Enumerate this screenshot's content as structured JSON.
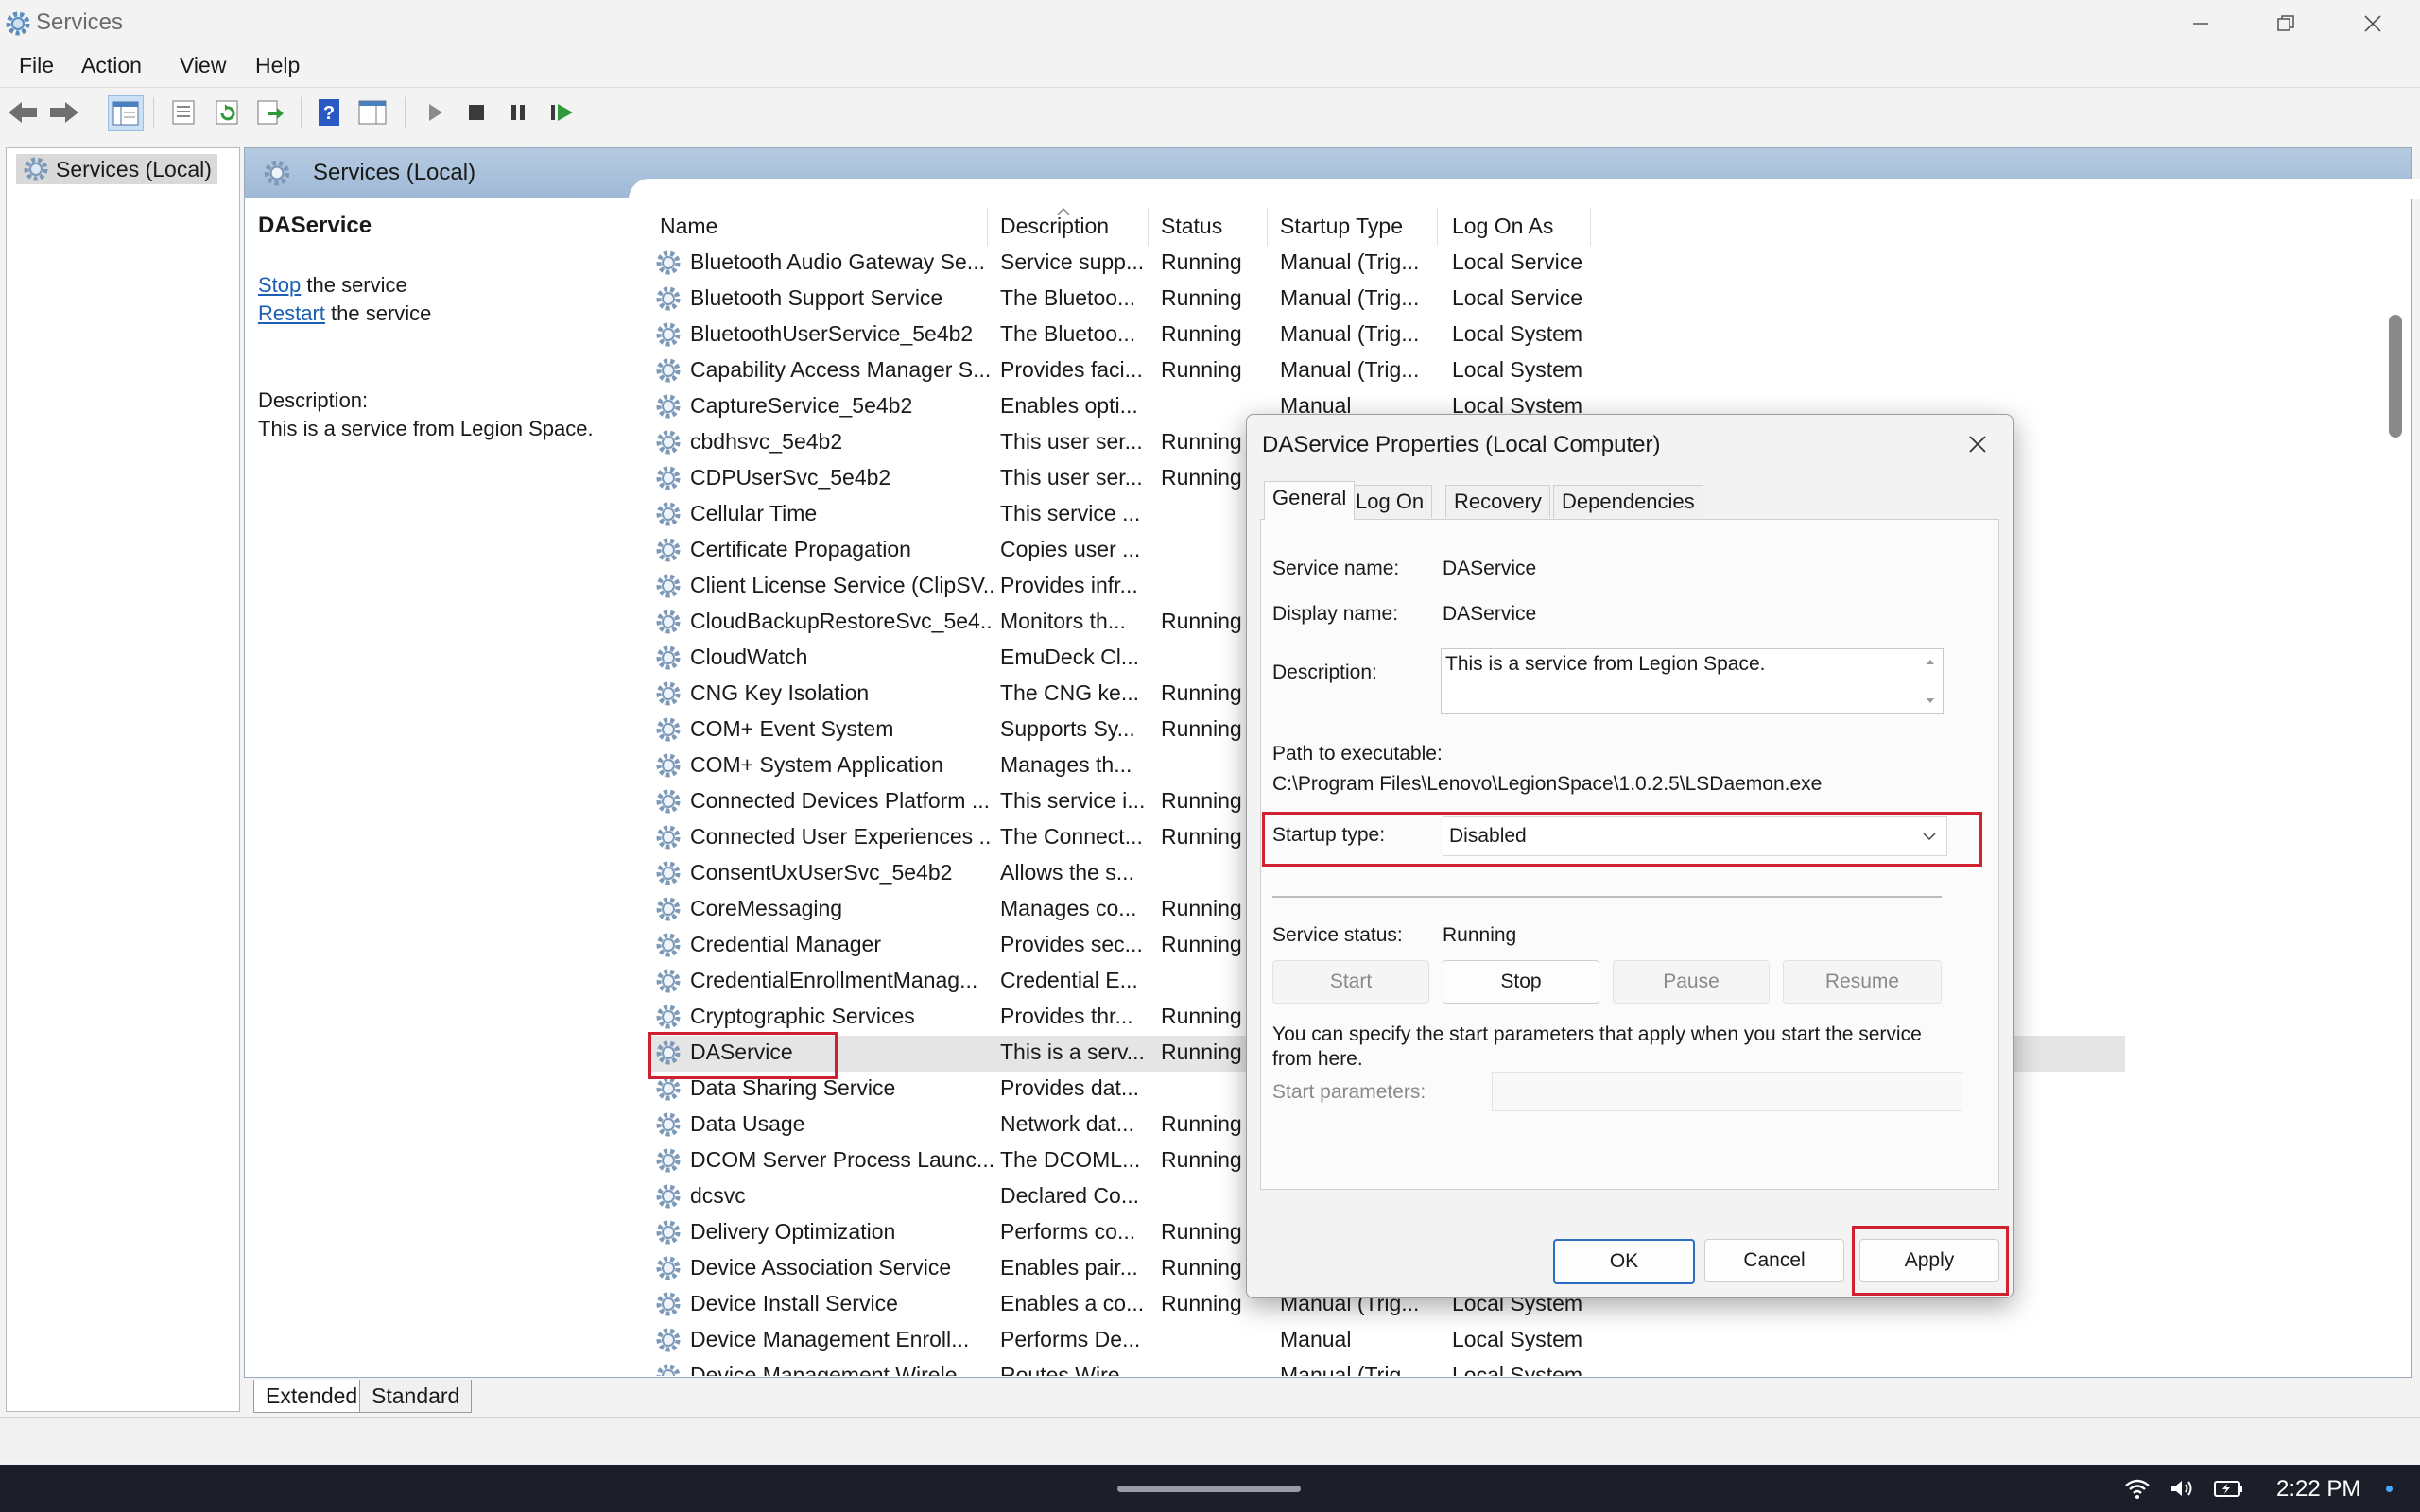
{
  "window": {
    "title": "Services"
  },
  "menu": [
    "File",
    "Action",
    "View",
    "Help"
  ],
  "tree": {
    "item": "Services (Local)"
  },
  "main": {
    "header": "Services (Local)",
    "selected_service": "DAService",
    "stop_link": "Stop",
    "stop_rest": " the service",
    "restart_link": "Restart",
    "restart_rest": " the service",
    "description_label": "Description:",
    "description_text": "This is a service from Legion Space."
  },
  "columns": [
    "Name",
    "Description",
    "Status",
    "Startup Type",
    "Log On As"
  ],
  "services": [
    {
      "name": "Bluetooth Audio Gateway Se...",
      "description": "Service supp...",
      "status": "Running",
      "startup": "Manual (Trig...",
      "logon": "Local Service"
    },
    {
      "name": "Bluetooth Support Service",
      "description": "The Bluetoo...",
      "status": "Running",
      "startup": "Manual (Trig...",
      "logon": "Local Service"
    },
    {
      "name": "BluetoothUserService_5e4b2",
      "description": "The Bluetoo...",
      "status": "Running",
      "startup": "Manual (Trig...",
      "logon": "Local System"
    },
    {
      "name": "Capability Access Manager S...",
      "description": "Provides faci...",
      "status": "Running",
      "startup": "Manual (Trig...",
      "logon": "Local System"
    },
    {
      "name": "CaptureService_5e4b2",
      "description": "Enables opti...",
      "status": "",
      "startup": "Manual",
      "logon": "Local System"
    },
    {
      "name": "cbdhsvc_5e4b2",
      "description": "This user ser...",
      "status": "Running",
      "startup": "",
      "logon": ""
    },
    {
      "name": "CDPUserSvc_5e4b2",
      "description": "This user ser...",
      "status": "Running",
      "startup": "",
      "logon": ""
    },
    {
      "name": "Cellular Time",
      "description": "This service ...",
      "status": "",
      "startup": "",
      "logon": ""
    },
    {
      "name": "Certificate Propagation",
      "description": "Copies user ...",
      "status": "",
      "startup": "",
      "logon": ""
    },
    {
      "name": "Client License Service (ClipSV...",
      "description": "Provides infr...",
      "status": "",
      "startup": "",
      "logon": ""
    },
    {
      "name": "CloudBackupRestoreSvc_5e4...",
      "description": "Monitors th...",
      "status": "Running",
      "startup": "",
      "logon": ""
    },
    {
      "name": "CloudWatch",
      "description": "EmuDeck Cl...",
      "status": "",
      "startup": "",
      "logon": ""
    },
    {
      "name": "CNG Key Isolation",
      "description": "The CNG ke...",
      "status": "Running",
      "startup": "",
      "logon": ""
    },
    {
      "name": "COM+ Event System",
      "description": "Supports Sy...",
      "status": "Running",
      "startup": "",
      "logon": ""
    },
    {
      "name": "COM+ System Application",
      "description": "Manages th...",
      "status": "",
      "startup": "",
      "logon": ""
    },
    {
      "name": "Connected Devices Platform ...",
      "description": "This service i...",
      "status": "Running",
      "startup": "",
      "logon": ""
    },
    {
      "name": "Connected User Experiences ...",
      "description": "The Connect...",
      "status": "Running",
      "startup": "",
      "logon": ""
    },
    {
      "name": "ConsentUxUserSvc_5e4b2",
      "description": "Allows the s...",
      "status": "",
      "startup": "",
      "logon": ""
    },
    {
      "name": "CoreMessaging",
      "description": "Manages co...",
      "status": "Running",
      "startup": "",
      "logon": ""
    },
    {
      "name": "Credential Manager",
      "description": "Provides sec...",
      "status": "Running",
      "startup": "",
      "logon": ""
    },
    {
      "name": "CredentialEnrollmentManag...",
      "description": "Credential E...",
      "status": "",
      "startup": "",
      "logon": ""
    },
    {
      "name": "Cryptographic Services",
      "description": "Provides thr...",
      "status": "Running",
      "startup": "",
      "logon": ""
    },
    {
      "name": "DAService",
      "description": "This is a serv...",
      "status": "Running",
      "startup": "",
      "logon": ""
    },
    {
      "name": "Data Sharing Service",
      "description": "Provides dat...",
      "status": "",
      "startup": "",
      "logon": ""
    },
    {
      "name": "Data Usage",
      "description": "Network dat...",
      "status": "Running",
      "startup": "",
      "logon": ""
    },
    {
      "name": "DCOM Server Process Launc...",
      "description": "The DCOML...",
      "status": "Running",
      "startup": "",
      "logon": ""
    },
    {
      "name": "dcsvc",
      "description": "Declared Co...",
      "status": "",
      "startup": "",
      "logon": ""
    },
    {
      "name": "Delivery Optimization",
      "description": "Performs co...",
      "status": "Running",
      "startup": "",
      "logon": ""
    },
    {
      "name": "Device Association Service",
      "description": "Enables pair...",
      "status": "Running",
      "startup": "",
      "logon": ""
    },
    {
      "name": "Device Install Service",
      "description": "Enables a co...",
      "status": "Running",
      "startup": "Manual (Trig...",
      "logon": "Local System"
    },
    {
      "name": "Device Management Enroll...",
      "description": "Performs De...",
      "status": "",
      "startup": "Manual",
      "logon": "Local System"
    },
    {
      "name": "Device Management Wirele...",
      "description": "Routes Wire...",
      "status": "",
      "startup": "Manual (Trig...",
      "logon": "Local System"
    }
  ],
  "bottom_tabs": [
    "Extended",
    "Standard"
  ],
  "dialog": {
    "title": "DAService Properties (Local Computer)",
    "tabs": [
      "General",
      "Log On",
      "Recovery",
      "Dependencies"
    ],
    "service_name_label": "Service name:",
    "service_name": "DAService",
    "display_name_label": "Display name:",
    "display_name": "DAService",
    "description_label": "Description:",
    "description": "This is a service from Legion Space.",
    "path_label": "Path to executable:",
    "path": "C:\\Program Files\\Lenovo\\LegionSpace\\1.0.2.5\\LSDaemon.exe",
    "startup_type_label": "Startup type:",
    "startup_type": "Disabled",
    "service_status_label": "Service status:",
    "service_status": "Running",
    "btn_start": "Start",
    "btn_stop": "Stop",
    "btn_pause": "Pause",
    "btn_resume": "Resume",
    "params_note": "You can specify the start parameters that apply when you start the service from here.",
    "start_params_label": "Start parameters:",
    "ok": "OK",
    "cancel": "Cancel",
    "apply": "Apply"
  },
  "taskbar": {
    "time": "2:22 PM"
  },
  "colors": {
    "highlight": "#d1202f",
    "link": "#1a5fb4",
    "header": "#a9c2de"
  }
}
